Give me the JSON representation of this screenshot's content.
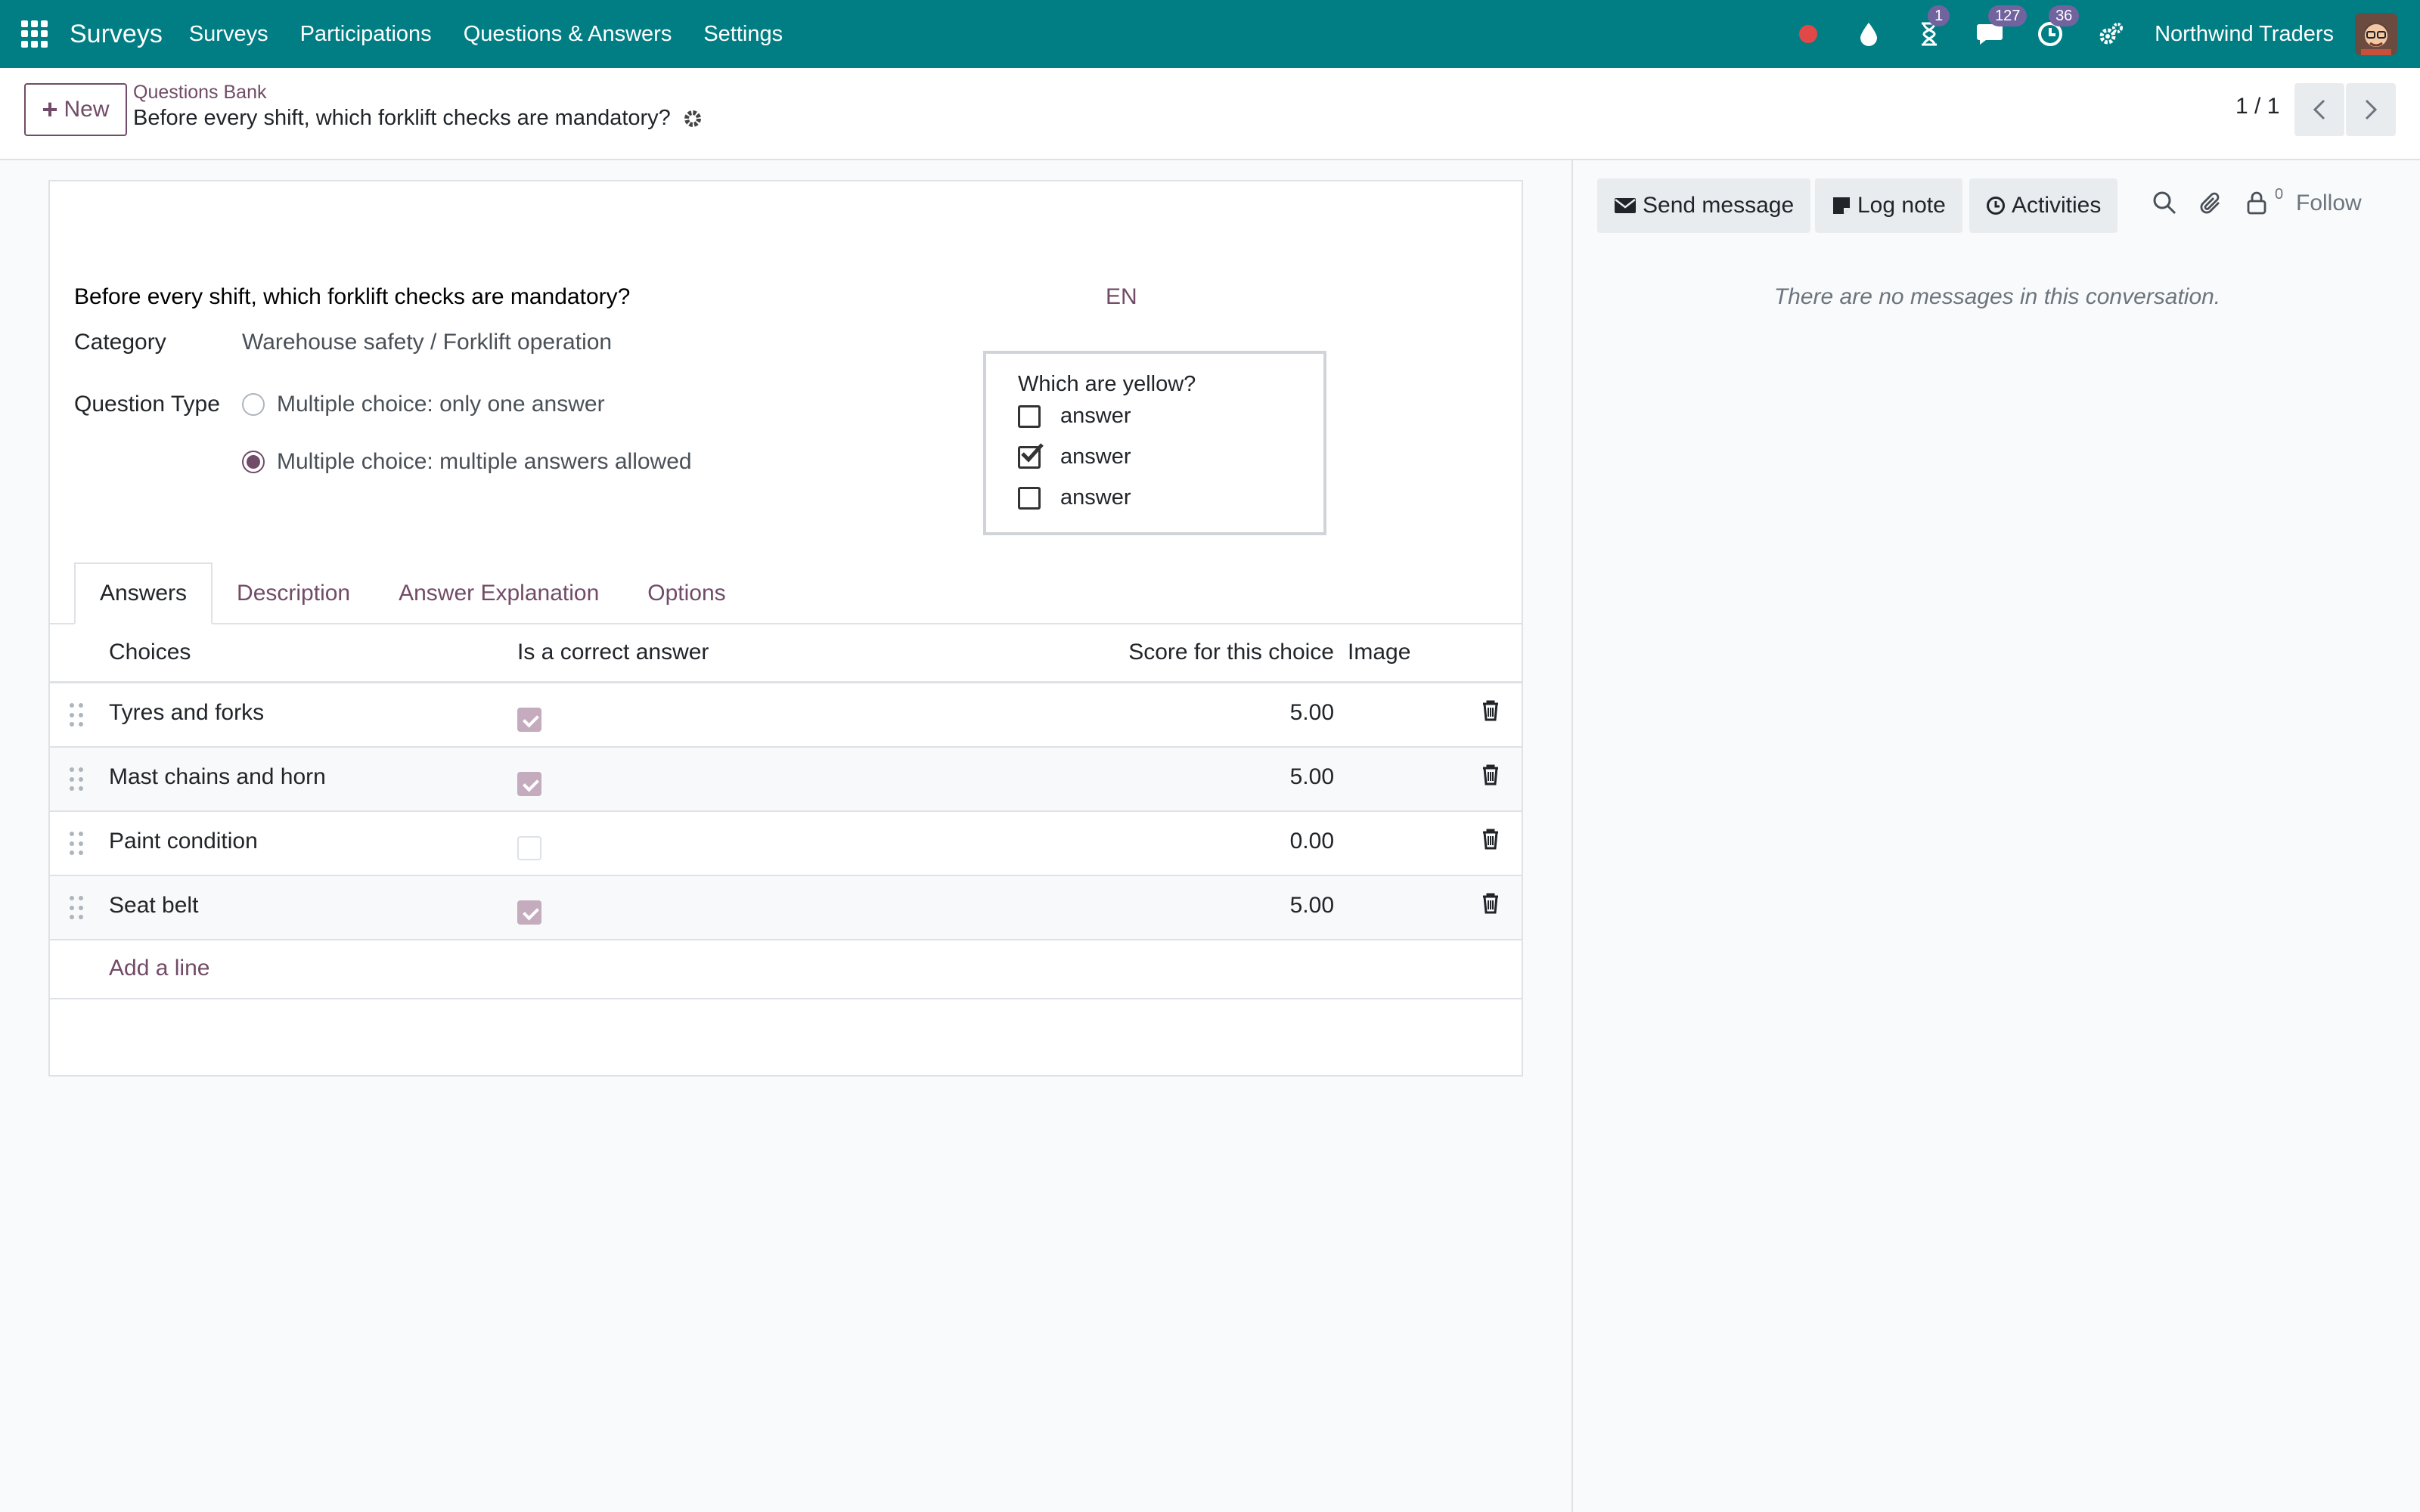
{
  "navbar": {
    "brand": "Surveys",
    "menu": [
      "Surveys",
      "Participations",
      "Questions & Answers",
      "Settings"
    ],
    "activity_badge": "1",
    "messages_badge": "127",
    "clock_badge": "36",
    "company": "Northwind Traders",
    "bg_color": "#017e84"
  },
  "control_panel": {
    "new_label": "New",
    "breadcrumb": "Questions Bank",
    "record_title": "Before every shift, which forklift checks are mandatory?",
    "pager": "1 / 1"
  },
  "form": {
    "question": "Before every shift, which forklift checks are mandatory?",
    "lang": "EN",
    "category_label": "Category",
    "category_value": "Warehouse safety / Forklift operation",
    "question_type_label": "Question Type",
    "question_type_options": [
      {
        "label": "Multiple choice: only one answer",
        "selected": false
      },
      {
        "label": "Multiple choice: multiple answers allowed",
        "selected": true
      }
    ],
    "preview": {
      "question": "Which are yellow?",
      "options": [
        {
          "label": "answer",
          "checked": false
        },
        {
          "label": "answer",
          "checked": true
        },
        {
          "label": "answer",
          "checked": false
        }
      ]
    },
    "tabs": [
      "Answers",
      "Description",
      "Answer Explanation",
      "Options"
    ],
    "active_tab": "Answers",
    "table": {
      "headers": {
        "choices": "Choices",
        "correct": "Is a correct answer",
        "score": "Score for this choice",
        "image": "Image"
      },
      "rows": [
        {
          "choice": "Tyres and forks",
          "correct": true,
          "score": "5.00"
        },
        {
          "choice": "Mast chains and horn",
          "correct": true,
          "score": "5.00"
        },
        {
          "choice": "Paint condition",
          "correct": false,
          "score": "0.00"
        },
        {
          "choice": "Seat belt",
          "correct": true,
          "score": "5.00"
        }
      ],
      "add_line": "Add a line"
    }
  },
  "chatter": {
    "send_message": "Send message",
    "log_note": "Log note",
    "activities": "Activities",
    "followers_count": "0",
    "follow": "Follow",
    "empty_text": "There are no messages in this conversation."
  },
  "colors": {
    "accent": "#714b67",
    "navbar": "#017e84"
  }
}
